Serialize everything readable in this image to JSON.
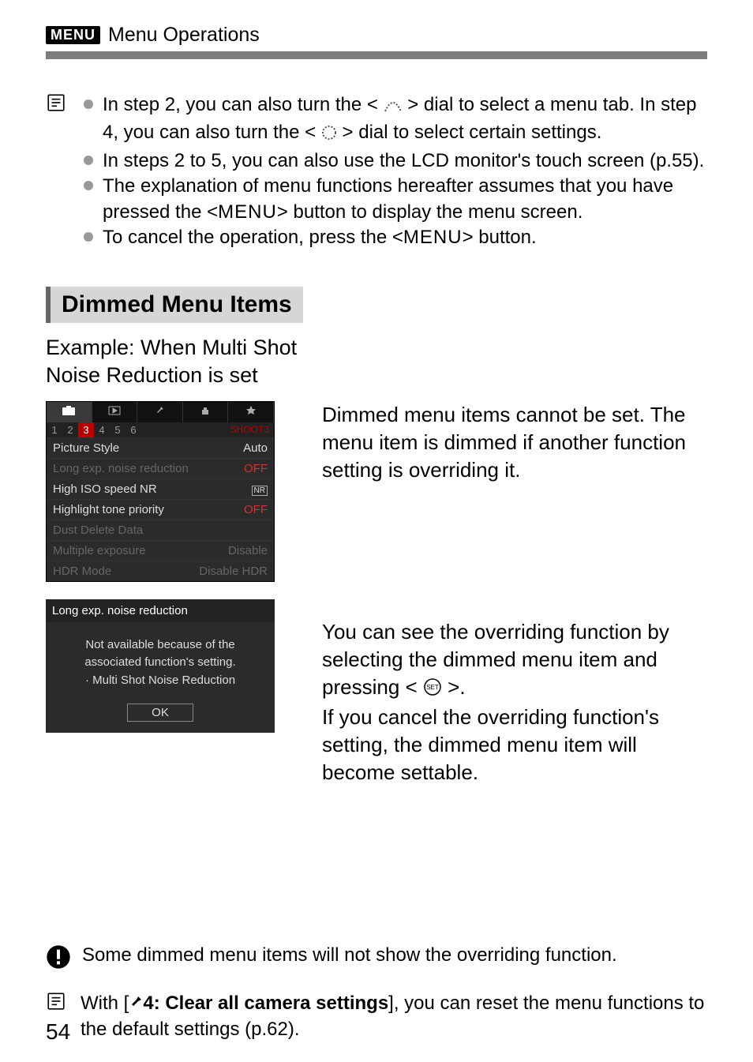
{
  "header": {
    "menu_icon_label": "MENU",
    "title": "Menu Operations"
  },
  "notes": [
    {
      "pre": "In step 2, you can also turn the <",
      "mid": "> dial to select a menu tab. In step 4, you can also turn the <",
      "post": "> dial to select certain settings."
    },
    {
      "text": "In steps 2 to 5, you can also use the LCD monitor's touch screen (p.55)."
    },
    {
      "pre": "The explanation of menu functions hereafter assumes that you have pressed the <",
      "menu": "MENU",
      "post": "> button to display the menu screen."
    },
    {
      "pre": "To cancel the operation, press the <",
      "menu": "MENU",
      "post": "> button."
    }
  ],
  "section_heading": "Dimmed Menu Items",
  "example_line1": "Example: When Multi Shot",
  "example_line2": "Noise Reduction is set",
  "menu_screenshot": {
    "subtabs": [
      "1",
      "2",
      "3",
      "4",
      "5",
      "6"
    ],
    "selected_subtab": "3",
    "shoot_label": "SHOOT3",
    "rows": [
      {
        "label": "Picture Style",
        "value": "Auto",
        "dim": false
      },
      {
        "label": "Long exp. noise reduction",
        "value": "OFF",
        "dim": true,
        "vred": true
      },
      {
        "label": "High ISO speed NR",
        "value": "NR",
        "dim": false,
        "vbox": true
      },
      {
        "label": "Highlight tone priority",
        "value": "OFF",
        "dim": false,
        "vred": true
      },
      {
        "label": "Dust Delete Data",
        "value": "",
        "dim": true
      },
      {
        "label": "Multiple exposure",
        "value": "Disable",
        "dim": true
      },
      {
        "label": "HDR Mode",
        "value": "Disable HDR",
        "dim": true
      }
    ]
  },
  "right_para1": "Dimmed menu items cannot be set. The menu item is dimmed if another function setting is overriding it.",
  "dialog": {
    "title": "Long exp. noise reduction",
    "l1": "Not available because of the",
    "l2": "associated function's setting.",
    "l3": "· Multi Shot Noise Reduction",
    "ok": "OK"
  },
  "right_para2a": "You can see the overriding function by selecting the dimmed menu item and pressing <",
  "right_para2b": ">.",
  "right_para3": "If you cancel the overriding function's setting, the dimmed menu item will become settable.",
  "warn_text": "Some dimmed menu items will not show the overriding function.",
  "info2_pre": "With [",
  "info2_bold": "4: Clear all camera settings",
  "info2_post": "], you can reset the menu functions to the default settings (p.62).",
  "page_number": "54"
}
